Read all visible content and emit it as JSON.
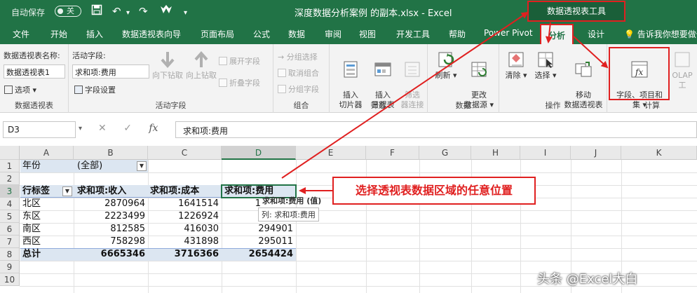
{
  "titlebar": {
    "autosave_label": "自动保存",
    "autosave_state": "关",
    "doc_title": "深度数据分析案例 的副本.xlsx  -  Excel",
    "context_tab_group": "数据透视表工具"
  },
  "tabs": [
    {
      "label": "文件"
    },
    {
      "label": "开始"
    },
    {
      "label": "插入"
    },
    {
      "label": "数据透视表向导"
    },
    {
      "label": "页面布局"
    },
    {
      "label": "公式"
    },
    {
      "label": "数据"
    },
    {
      "label": "审阅"
    },
    {
      "label": "视图"
    },
    {
      "label": "开发工具"
    },
    {
      "label": "帮助"
    },
    {
      "label": "Power Pivot"
    },
    {
      "label": "分析",
      "active": true
    },
    {
      "label": "设计"
    }
  ],
  "tell_me": "告诉我你想要做什么",
  "ribbon": {
    "pivot_name_label": "数据透视表名称:",
    "pivot_name_value": "数据透视表1",
    "options_label": "选项",
    "group_pivot": "数据透视表",
    "active_field_label": "活动字段:",
    "active_field_value": "求和项:费用",
    "field_settings": "字段设置",
    "drill_down": "向下钻取",
    "drill_up": "向上钻取",
    "expand_field": "展开字段",
    "collapse_field": "折叠字段",
    "group_active_field": "活动字段",
    "group_selection": "分组选择",
    "ungroup": "取消组合",
    "group_field": "分组字段",
    "group_group": "组合",
    "insert_slicer": "插入\n切片器",
    "insert_timeline": "插入\n日程表",
    "filter_connections": "筛选\n器连接",
    "group_filter": "筛选",
    "refresh": "刷新",
    "change_source": "更改\n数据源",
    "group_data": "数据",
    "clear": "清除",
    "select": "选择",
    "move_pivot": "移动\n数据透视表",
    "group_actions": "操作",
    "fields_items_sets": "字段、项目和\n集",
    "olap_tools": "OLAP 工",
    "group_calc": "计算"
  },
  "formula_bar": {
    "cell_ref": "D3",
    "formula": "求和项:费用"
  },
  "grid": {
    "columns": [
      "A",
      "B",
      "C",
      "D",
      "E",
      "F",
      "G",
      "H",
      "I",
      "J",
      "K"
    ],
    "rows": [
      "1",
      "2",
      "3",
      "4",
      "5",
      "6",
      "7",
      "8",
      "9",
      "10"
    ],
    "filter_label": "年份",
    "filter_value": "(全部)",
    "headers": [
      "行标签",
      "求和项:收入",
      "求和项:成本",
      "求和项:费用"
    ],
    "data": [
      {
        "label": "北区",
        "income": "2870964",
        "cost": "1641514",
        "expense": "1"
      },
      {
        "label": "东区",
        "income": "2223499",
        "cost": "1226924",
        "expense": ""
      },
      {
        "label": "南区",
        "income": "812585",
        "cost": "416030",
        "expense": "294901"
      },
      {
        "label": "西区",
        "income": "758298",
        "cost": "431898",
        "expense": "295011"
      }
    ],
    "total": {
      "label": "总计",
      "income": "6665346",
      "cost": "3716366",
      "expense": "2654424"
    }
  },
  "tooltip": {
    "line1": "求和项:费用 (值)",
    "line2": "列: 求和项:费用"
  },
  "callout": "选择透视表数据区域的任意位置",
  "watermark": "头条 @Excel大白",
  "colors": {
    "excel_green": "#217346",
    "annotation_red": "#e02020",
    "pivot_band": "#dce6f1"
  }
}
